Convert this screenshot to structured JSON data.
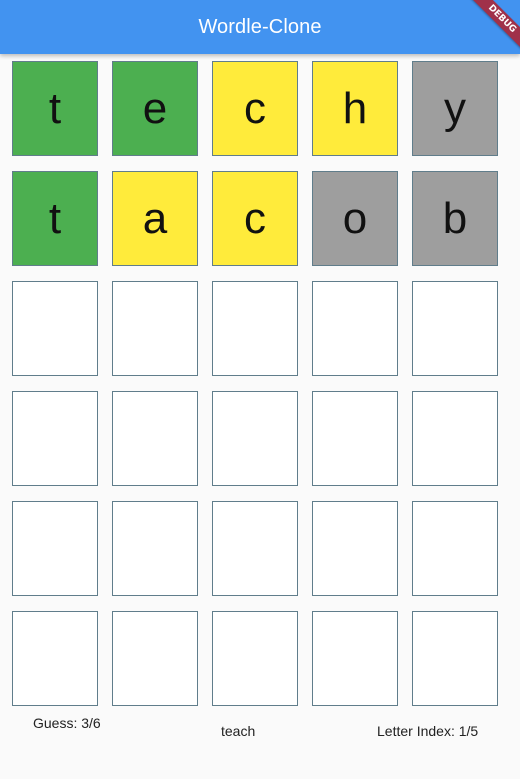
{
  "app_bar": {
    "title": "Wordle-Clone",
    "debug_label": "DEBUG"
  },
  "colors": {
    "app_bar": "#4293f0",
    "correct": "#4caf50",
    "present": "#ffeb3b",
    "absent": "#9e9e9e",
    "empty": "#ffffff"
  },
  "board": {
    "rows": [
      [
        {
          "letter": "t",
          "state": "green"
        },
        {
          "letter": "e",
          "state": "green"
        },
        {
          "letter": "c",
          "state": "yellow"
        },
        {
          "letter": "h",
          "state": "yellow"
        },
        {
          "letter": "y",
          "state": "grey"
        }
      ],
      [
        {
          "letter": "t",
          "state": "green"
        },
        {
          "letter": "a",
          "state": "yellow"
        },
        {
          "letter": "c",
          "state": "yellow"
        },
        {
          "letter": "o",
          "state": "grey"
        },
        {
          "letter": "b",
          "state": "grey"
        }
      ],
      [
        {
          "letter": "",
          "state": "empty"
        },
        {
          "letter": "",
          "state": "empty"
        },
        {
          "letter": "",
          "state": "empty"
        },
        {
          "letter": "",
          "state": "empty"
        },
        {
          "letter": "",
          "state": "empty"
        }
      ],
      [
        {
          "letter": "",
          "state": "empty"
        },
        {
          "letter": "",
          "state": "empty"
        },
        {
          "letter": "",
          "state": "empty"
        },
        {
          "letter": "",
          "state": "empty"
        },
        {
          "letter": "",
          "state": "empty"
        }
      ],
      [
        {
          "letter": "",
          "state": "empty"
        },
        {
          "letter": "",
          "state": "empty"
        },
        {
          "letter": "",
          "state": "empty"
        },
        {
          "letter": "",
          "state": "empty"
        },
        {
          "letter": "",
          "state": "empty"
        }
      ],
      [
        {
          "letter": "",
          "state": "empty"
        },
        {
          "letter": "",
          "state": "empty"
        },
        {
          "letter": "",
          "state": "empty"
        },
        {
          "letter": "",
          "state": "empty"
        },
        {
          "letter": "",
          "state": "empty"
        }
      ]
    ]
  },
  "status": {
    "guess": "Guess: 3/6",
    "word": "teach",
    "letter_index": "Letter Index: 1/5"
  }
}
